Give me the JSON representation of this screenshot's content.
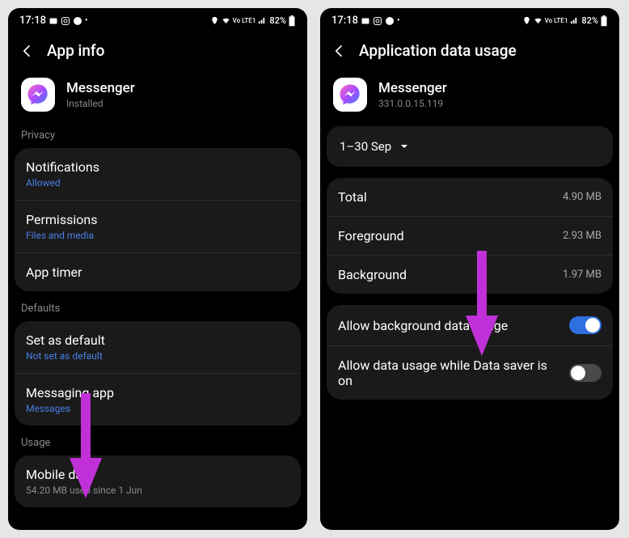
{
  "status": {
    "time": "17:18",
    "lte_text": "Vo LTE1",
    "battery_text": "82%"
  },
  "left": {
    "title": "App info",
    "app_name": "Messenger",
    "app_sub": "Installed",
    "privacy_label": "Privacy",
    "notifications": {
      "label": "Notifications",
      "sub": "Allowed"
    },
    "permissions": {
      "label": "Permissions",
      "sub": "Files and media"
    },
    "app_timer": {
      "label": "App timer"
    },
    "defaults_label": "Defaults",
    "set_default": {
      "label": "Set as default",
      "sub": "Not set as default"
    },
    "messaging_app": {
      "label": "Messaging app",
      "sub": "Messages"
    },
    "usage_label": "Usage",
    "mobile_data": {
      "label": "Mobile data",
      "sub": "54.20 MB used since 1 Jun"
    }
  },
  "right": {
    "title": "Application data usage",
    "app_name": "Messenger",
    "app_sub": "331.0.0.15.119",
    "date_range": "1–30 Sep",
    "total": {
      "label": "Total",
      "value": "4.90 MB"
    },
    "foreground": {
      "label": "Foreground",
      "value": "2.93 MB"
    },
    "background": {
      "label": "Background",
      "value": "1.97 MB"
    },
    "allow_bg": {
      "label": "Allow background data usage",
      "on": true
    },
    "allow_ds": {
      "label": "Allow data usage while Data saver is on",
      "on": false
    }
  }
}
